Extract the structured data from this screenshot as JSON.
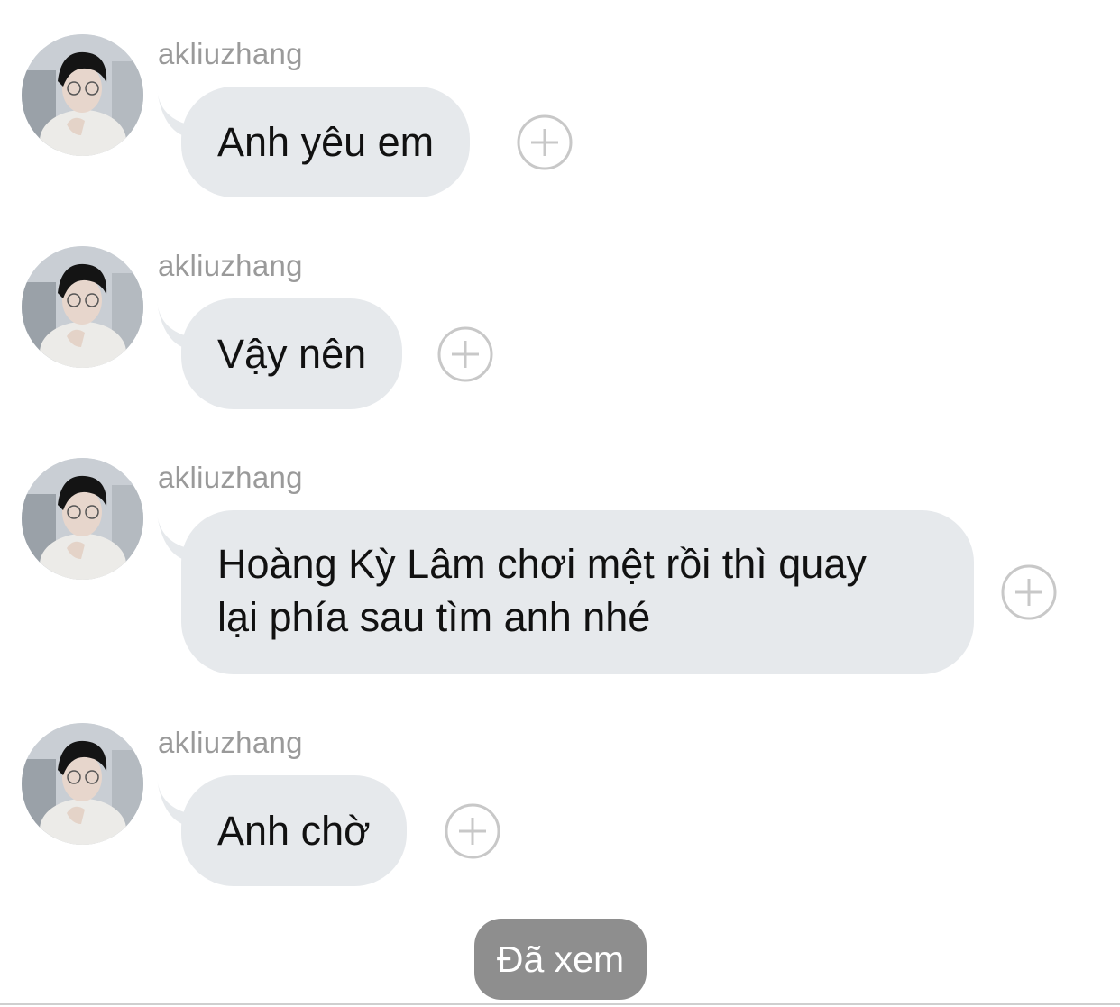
{
  "messages": [
    {
      "sender": "akliuzhang",
      "lines": [
        "Anh yêu em"
      ]
    },
    {
      "sender": "akliuzhang",
      "lines": [
        "Vậy nên"
      ]
    },
    {
      "sender": "akliuzhang",
      "lines": [
        "Hoàng Kỳ Lâm chơi mệt rồi thì quay",
        "lại phía sau tìm anh nhé"
      ]
    },
    {
      "sender": "akliuzhang",
      "lines": [
        "Anh chờ"
      ]
    }
  ],
  "status": {
    "seen_label": "Đã xem"
  },
  "colors": {
    "bubble": "#e6e9ec",
    "sender_text": "#9a9a9a",
    "seen_badge": "#8e8e8e",
    "plus_icon": "#c8c8c8"
  },
  "icons": {
    "reaction": "plus-circle-icon",
    "avatar": "profile-photo"
  }
}
